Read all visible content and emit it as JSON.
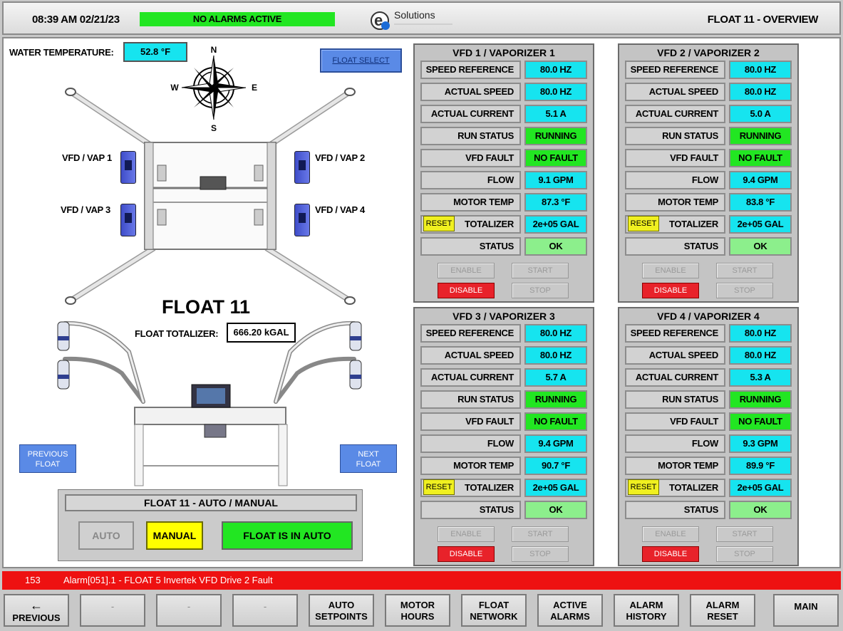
{
  "header": {
    "datetime": "08:39 AM 02/21/23",
    "alarm_status": "NO ALARMS ACTIVE",
    "logo_text": "Solutions",
    "screen_title": "FLOAT 11 - OVERVIEW"
  },
  "water": {
    "label": "WATER TEMPERATURE:",
    "value": "52.8 °F"
  },
  "float_select_label": "FLOAT SELECT",
  "compass": {
    "n": "N",
    "s": "S",
    "e": "E",
    "w": "W"
  },
  "vaps": [
    "VFD / VAP 1",
    "VFD / VAP  2",
    "VFD / VAP 3",
    "VFD / VAP 4"
  ],
  "float_title": "FLOAT 11",
  "float_totalizer": {
    "label": "FLOAT TOTALIZER:",
    "value": "666.20 kGAL"
  },
  "nav_float": {
    "prev_line1": "PREVIOUS",
    "prev_line2": "FLOAT",
    "next_line1": "NEXT",
    "next_line2": "FLOAT"
  },
  "auto_manual": {
    "title": "FLOAT 11 - AUTO / MANUAL",
    "auto_label": "AUTO",
    "manual_label": "MANUAL",
    "status": "FLOAT IS IN AUTO"
  },
  "vfd_row_labels": [
    "SPEED REFERENCE",
    "ACTUAL SPEED",
    "ACTUAL CURRENT",
    "RUN STATUS",
    "VFD FAULT",
    "FLOW",
    "MOTOR TEMP",
    "TOTALIZER",
    "STATUS"
  ],
  "vfd_buttons": {
    "enable": "ENABLE",
    "start": "START",
    "disable": "DISABLE",
    "stop": "STOP",
    "reset": "RESET"
  },
  "vfds": [
    {
      "title": "VFD 1 / VAPORIZER 1",
      "values": [
        "80.0 HZ",
        "80.0 HZ",
        "5.1 A",
        "RUNNING",
        "NO FAULT",
        "9.1 GPM",
        "87.3 °F",
        "2e+05 GAL",
        "OK"
      ]
    },
    {
      "title": "VFD 2 / VAPORIZER 2",
      "values": [
        "80.0 HZ",
        "80.0 HZ",
        "5.0 A",
        "RUNNING",
        "NO FAULT",
        "9.4 GPM",
        "83.8 °F",
        "2e+05 GAL",
        "OK"
      ]
    },
    {
      "title": "VFD 3 / VAPORIZER 3",
      "values": [
        "80.0 HZ",
        "80.0 HZ",
        "5.7 A",
        "RUNNING",
        "NO FAULT",
        "9.4 GPM",
        "90.7 °F",
        "2e+05 GAL",
        "OK"
      ]
    },
    {
      "title": "VFD 4 / VAPORIZER 4",
      "values": [
        "80.0 HZ",
        "80.0 HZ",
        "5.3 A",
        "RUNNING",
        "NO FAULT",
        "9.3 GPM",
        "89.9 °F",
        "2e+05 GAL",
        "OK"
      ]
    }
  ],
  "alarm_bar": {
    "number": "153",
    "text": "Alarm[051].1 - FLOAT 5 Invertek VFD Drive 2 Fault"
  },
  "nav": [
    {
      "line1": "←",
      "line2": "PREVIOUS"
    },
    {
      "line1": "-",
      "line2": ""
    },
    {
      "line1": "-",
      "line2": ""
    },
    {
      "line1": "-",
      "line2": ""
    },
    {
      "line1": "AUTO",
      "line2": "SETPOINTS"
    },
    {
      "line1": "MOTOR",
      "line2": "HOURS"
    },
    {
      "line1": "FLOAT",
      "line2": "NETWORK"
    },
    {
      "line1": "ACTIVE",
      "line2": "ALARMS"
    },
    {
      "line1": "ALARM",
      "line2": "HISTORY"
    },
    {
      "line1": "ALARM",
      "line2": "RESET"
    },
    {
      "line1": "MAIN",
      "line2": ""
    }
  ]
}
